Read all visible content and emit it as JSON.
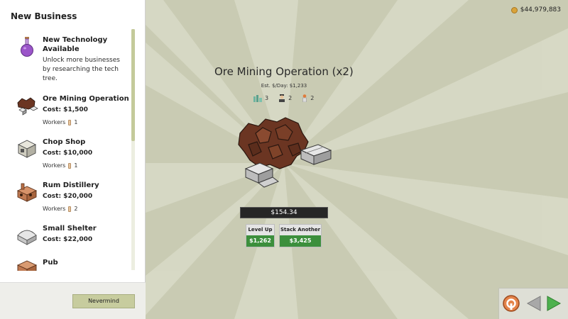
{
  "money": {
    "amount": "$44,979,883",
    "icon": "coin-icon"
  },
  "detail": {
    "title": "Ore Mining Operation (x2)",
    "est_day": "Est. $/Day: $1,233",
    "stats": {
      "buildings": "3",
      "managers": "2",
      "workers": "2"
    },
    "income": "$154.34",
    "level_up": {
      "label": "Level Up",
      "price": "$1,262"
    },
    "stack_another": {
      "label": "Stack Another",
      "price": "$3,425"
    }
  },
  "sidebar": {
    "title": "New Business",
    "items": [
      {
        "name": "New Technology Available",
        "desc": "Unlock more businesses by researching the tech tree.",
        "icon": "potion-flask-icon"
      },
      {
        "name": "Ore Mining Operation",
        "cost": "Cost: $1,500",
        "workers_label": "Workers",
        "workers": "1",
        "icon": "ore-rocks-icon"
      },
      {
        "name": "Chop Shop",
        "cost": "Cost: $10,000",
        "workers_label": "Workers",
        "workers": "1",
        "icon": "chop-shop-icon"
      },
      {
        "name": "Rum Distillery",
        "cost": "Cost: $20,000",
        "workers_label": "Workers",
        "workers": "2",
        "icon": "distillery-icon"
      },
      {
        "name": "Small Shelter",
        "cost": "Cost: $22,000",
        "icon": "shelter-icon"
      },
      {
        "name": "Pub",
        "icon": "pub-icon"
      }
    ],
    "footer_button": "Nevermind"
  },
  "colors": {
    "accent_green": "#3c8f3c",
    "sidebar_button": "#c7cc9e",
    "background": "#c9cbb3"
  }
}
